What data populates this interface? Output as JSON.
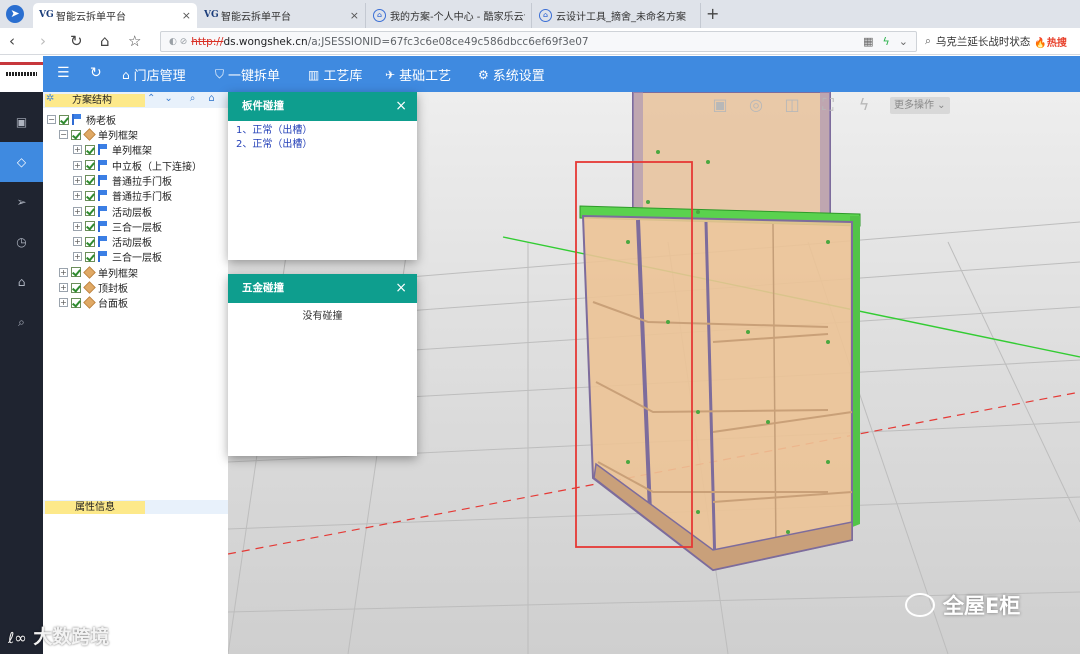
{
  "browser": {
    "tabs": [
      {
        "label": "智能云拆单平台",
        "favicon": "vg-logo-icon",
        "close": "×",
        "active": true
      },
      {
        "label": "智能云拆单平台",
        "favicon": "vg-logo-icon",
        "close": "×",
        "active": false
      },
      {
        "label": "我的方案-个人中心 - 酷家乐云设",
        "favicon": "cloud-design-icon",
        "close": "×",
        "active": false
      },
      {
        "label": "云设计工具_摘舍_未命名方案",
        "favicon": "cloud-design-icon",
        "close": "×",
        "active": false
      }
    ],
    "new_tab": "+",
    "address": {
      "protocol": "http://",
      "host": "ds.wongshek.cn",
      "path": "/a;JSESSIONID=67fc3c6e08ce49c586dbcc6ef69f3e07"
    },
    "search": {
      "text": "乌克兰延长战时状态",
      "hot": "热搜"
    }
  },
  "app": {
    "menu": [
      {
        "label": "门店管理",
        "icon": "home-icon"
      },
      {
        "label": "一键拆单",
        "icon": "shield-check-icon"
      },
      {
        "label": "工艺库",
        "icon": "book-icon"
      },
      {
        "label": "基础工艺",
        "icon": "rocket-icon"
      },
      {
        "label": "系统设置",
        "icon": "gear-icon"
      }
    ],
    "rail": [
      "image-icon",
      "diamond-icon",
      "send-icon",
      "clock-icon",
      "bank-icon",
      "search-icon"
    ]
  },
  "tree": {
    "title": "方案结构",
    "root": "杨老板",
    "nodes": [
      {
        "label": "单列框架",
        "level": 1,
        "type": "box"
      },
      {
        "label": "单列框架",
        "level": 2,
        "type": "flag"
      },
      {
        "label": "中立板（上下连接）",
        "level": 2,
        "type": "flag"
      },
      {
        "label": "普通拉手门板",
        "level": 2,
        "type": "flag"
      },
      {
        "label": "普通拉手门板",
        "level": 2,
        "type": "flag"
      },
      {
        "label": "活动层板",
        "level": 2,
        "type": "flag"
      },
      {
        "label": "三合一层板",
        "level": 2,
        "type": "flag"
      },
      {
        "label": "活动层板",
        "level": 2,
        "type": "flag"
      },
      {
        "label": "三合一层板",
        "level": 2,
        "type": "flag"
      },
      {
        "label": "单列框架",
        "level": 1,
        "type": "box"
      },
      {
        "label": "顶封板",
        "level": 1,
        "type": "box"
      },
      {
        "label": "台面板",
        "level": 1,
        "type": "box"
      }
    ],
    "properties_title": "属性信息"
  },
  "panel_collision": {
    "title": "板件碰撞",
    "items": [
      "1、正常（出槽）",
      "2、正常（出槽）"
    ],
    "close": "×"
  },
  "hardware_collision": {
    "title": "五金碰撞",
    "message": "没有碰撞",
    "close": "×"
  },
  "viewport": {
    "more_ops": "更多操作"
  },
  "watermarks": {
    "left": "大数跨境",
    "right": "全屋E柜"
  },
  "colors": {
    "accent": "#3f8ae0",
    "dialog_header": "#0e9e8e",
    "highlight_box": "#e53935",
    "axis_green": "#33cc33",
    "axis_red": "#e53935"
  }
}
